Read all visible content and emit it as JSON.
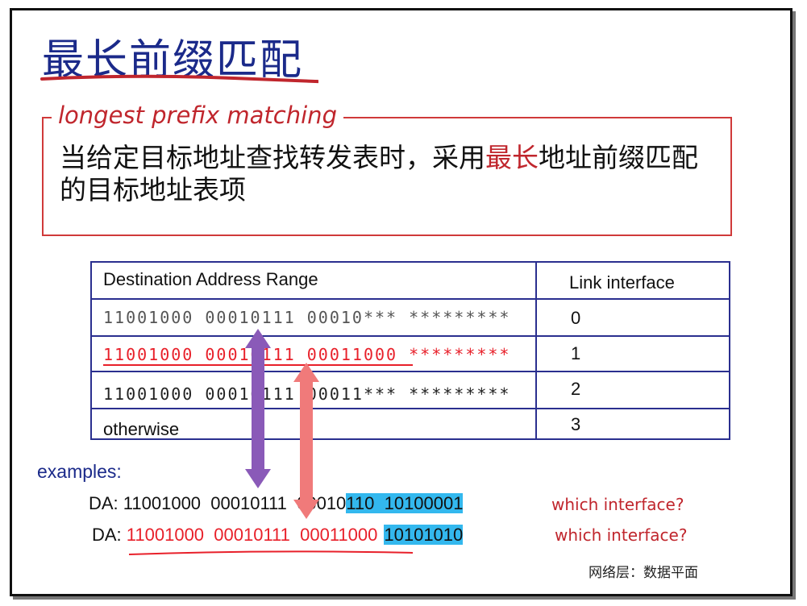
{
  "title": "最长前缀匹配",
  "definition": {
    "heading": "longest prefix matching",
    "text_before": "当给定目标地址查找转发表时，采用",
    "text_highlight": "最长",
    "text_after": "地址前缀匹配的目标地址表项"
  },
  "table": {
    "headers": {
      "range": "Destination Address Range",
      "iface": "Link interface"
    },
    "rows": [
      {
        "range": "11001000 00010111 00010*** *********",
        "iface": "0"
      },
      {
        "range": "11001000 00010111 00011000 *********",
        "iface": "1"
      },
      {
        "range": "11001000 00010111 00011*** *********",
        "iface": "2"
      },
      {
        "range": "otherwise",
        "iface": "3"
      }
    ]
  },
  "examples": {
    "label": "examples:",
    "items": [
      {
        "prefix": "DA: ",
        "part_a": "11001000  00010111  00010",
        "part_b": "110  10100001",
        "question": "which interface?"
      },
      {
        "prefix": "DA: ",
        "part_a": "11001000  00010111  00011000",
        "part_b": "10101010",
        "question": "which interface?"
      }
    ]
  },
  "footer": "网络层：数据平面",
  "colors": {
    "title": "#1b2a8a",
    "accent_red": "#c0262d",
    "table_border": "#2a2f8f",
    "highlight_blue": "#33b8ee",
    "arrow_purple": "#8a5ab8",
    "arrow_pink": "#f07a7a"
  }
}
